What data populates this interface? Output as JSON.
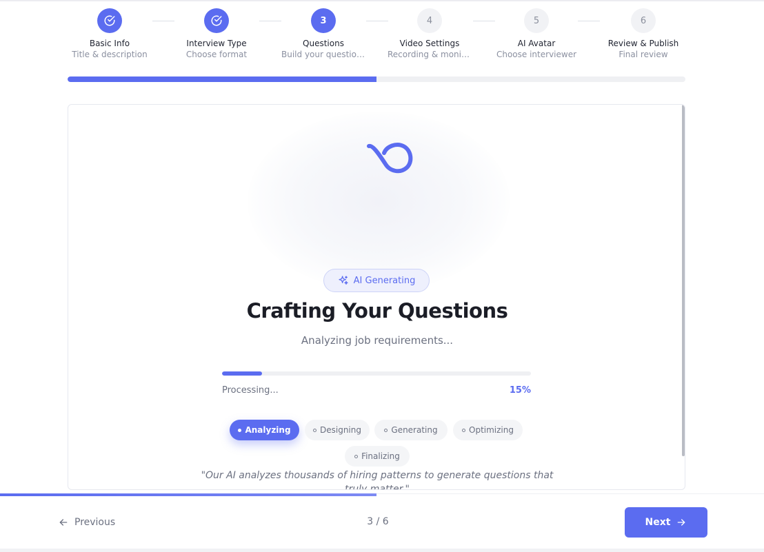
{
  "stepper": {
    "steps": [
      {
        "number": "1",
        "title": "Basic Info",
        "subtitle": "Title & description",
        "status": "done"
      },
      {
        "number": "2",
        "title": "Interview Type",
        "subtitle": "Choose format",
        "status": "done"
      },
      {
        "number": "3",
        "title": "Questions",
        "subtitle": "Build your questions",
        "status": "active"
      },
      {
        "number": "4",
        "title": "Video Settings",
        "subtitle": "Recording & monitoring",
        "status": "todo"
      },
      {
        "number": "5",
        "title": "AI Avatar",
        "subtitle": "Choose interviewer",
        "status": "todo"
      },
      {
        "number": "6",
        "title": "Review & Publish",
        "subtitle": "Final review",
        "status": "todo"
      }
    ],
    "overall_progress_fraction": 0.5
  },
  "generator": {
    "badge_label": "AI Generating",
    "headline": "Crafting Your Questions",
    "status_text": "Analyzing job requirements...",
    "progress_label": "Processing...",
    "progress_percent_text": "15%",
    "progress_fraction": 0.13,
    "phases": [
      {
        "label": "Analyzing",
        "active": true
      },
      {
        "label": "Designing",
        "active": false
      },
      {
        "label": "Generating",
        "active": false
      },
      {
        "label": "Optimizing",
        "active": false
      },
      {
        "label": "Finalizing",
        "active": false
      }
    ],
    "quote": "\"Our AI analyzes thousands of hiring patterns to generate questions that truly matter.\""
  },
  "footer": {
    "previous_label": "Previous",
    "page_counter": "3 / 6",
    "next_label": "Next"
  },
  "colors": {
    "accent": "#5b6cf0",
    "inactive_step": "#f1f2f5",
    "track": "#eff0f3"
  },
  "icons": {
    "done": "check-circle-icon",
    "badge": "sparkles-icon",
    "hero": "loop-icon",
    "previous": "arrow-left-icon",
    "next": "arrow-right-icon"
  }
}
